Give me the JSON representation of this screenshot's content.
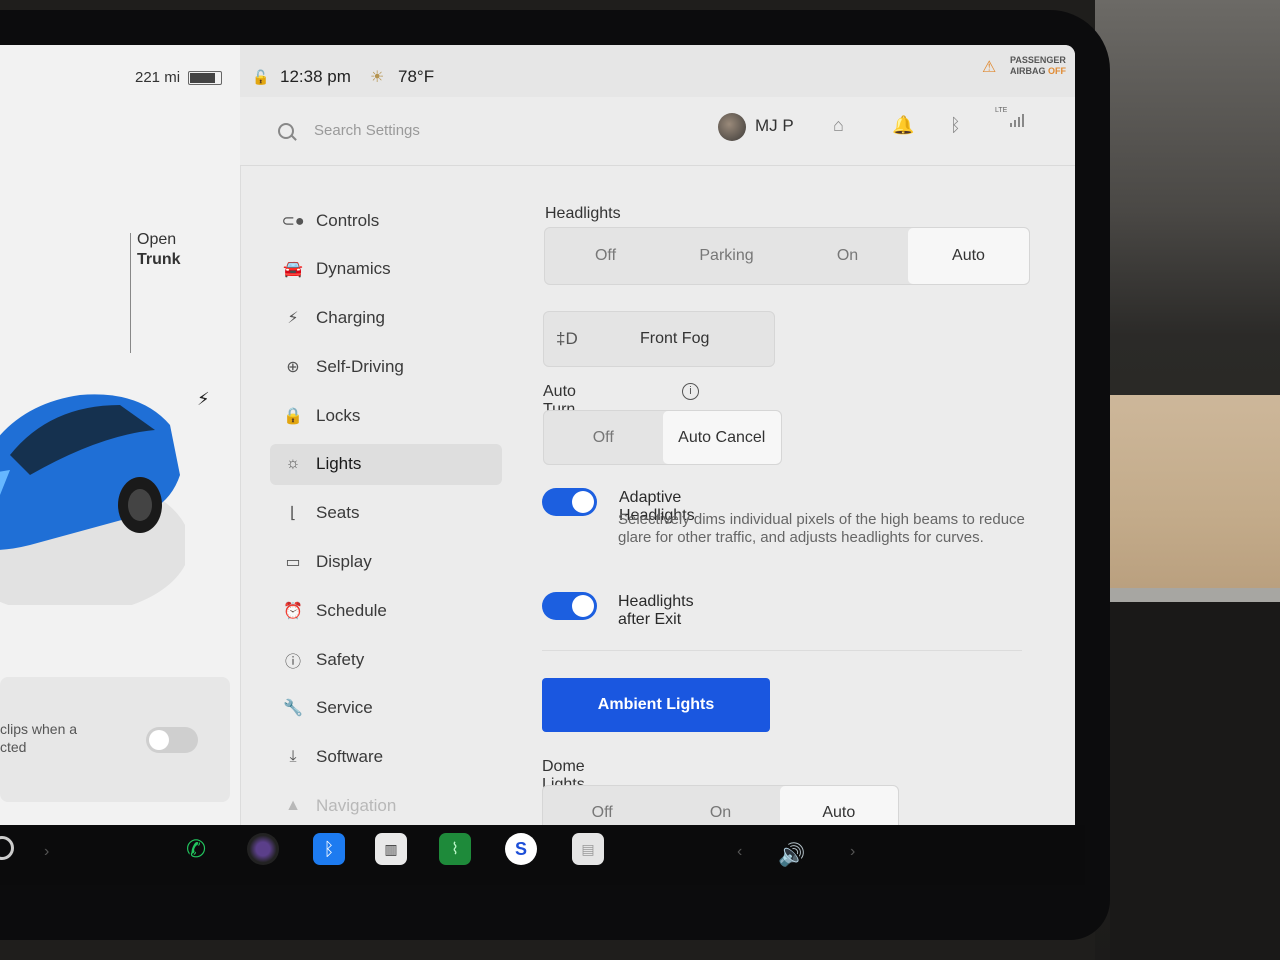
{
  "status_bar": {
    "range": "221 mi",
    "time": "12:38 pm",
    "temperature": "78°F",
    "airbag_line1": "PASSENGER",
    "airbag_line2": "AIRBAG",
    "airbag_status": "OFF",
    "lte_label": "LTE"
  },
  "car_panel": {
    "trunk_line1": "Open",
    "trunk_line2": "Trunk",
    "card_line1": "clips when a",
    "card_line2": "cted"
  },
  "header": {
    "search_placeholder": "Search Settings",
    "profile_name": "MJ P"
  },
  "nav": {
    "items": [
      {
        "label": "Controls",
        "icon": "toggle-icon"
      },
      {
        "label": "Dynamics",
        "icon": "car-icon"
      },
      {
        "label": "Charging",
        "icon": "bolt-icon"
      },
      {
        "label": "Self-Driving",
        "icon": "steering-wheel-icon"
      },
      {
        "label": "Locks",
        "icon": "lock-icon"
      },
      {
        "label": "Lights",
        "icon": "sun-icon",
        "active": true
      },
      {
        "label": "Seats",
        "icon": "seat-icon"
      },
      {
        "label": "Display",
        "icon": "display-icon"
      },
      {
        "label": "Schedule",
        "icon": "alarm-clock-icon"
      },
      {
        "label": "Safety",
        "icon": "alert-circle-icon"
      },
      {
        "label": "Service",
        "icon": "wrench-icon"
      },
      {
        "label": "Software",
        "icon": "download-icon"
      },
      {
        "label": "Navigation",
        "icon": "navigation-arrow-icon"
      }
    ]
  },
  "lights": {
    "headlights_title": "Headlights",
    "headlights_options": [
      "Off",
      "Parking",
      "On",
      "Auto"
    ],
    "headlights_selected": "Auto",
    "front_fog_label": "Front Fog",
    "auto_turn_title": "Auto Turn Signals",
    "auto_turn_options": [
      "Off",
      "Auto Cancel"
    ],
    "auto_turn_selected": "Auto Cancel",
    "adaptive_title": "Adaptive Headlights",
    "adaptive_desc": "Selectively dims individual pixels of the high beams to reduce glare for other traffic, and adjusts headlights for curves.",
    "adaptive_on": true,
    "after_exit_title": "Headlights after Exit",
    "after_exit_on": true,
    "ambient_button": "Ambient Lights",
    "dome_title": "Dome Lights",
    "dome_options": [
      "Off",
      "On",
      "Auto"
    ],
    "dome_selected": "Auto"
  },
  "colors": {
    "accent_blue": "#1a57e0",
    "toggle_blue": "#1c5fe0"
  }
}
